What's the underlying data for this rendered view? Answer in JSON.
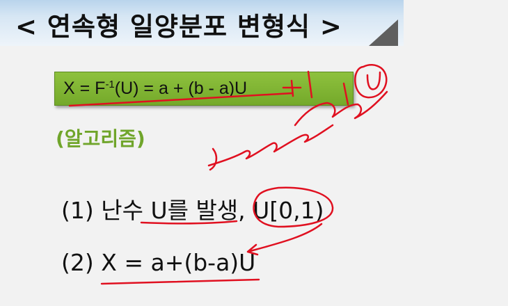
{
  "title": "< 연속형 일양분포 변형식 >",
  "formula": {
    "lhs": "X = F",
    "superscript": "-1",
    "rhs": "(U) = a + (b - a)U"
  },
  "algorithm_label": "(알고리즘)",
  "steps": [
    "(1) 난수 U를 발생, U[0,1)",
    "(2) X = a+(b-a)U"
  ],
  "colors": {
    "banner": "#c9def2",
    "formula_box": "#82b535",
    "algorithm": "#70a52b",
    "ink": "#e01020"
  }
}
